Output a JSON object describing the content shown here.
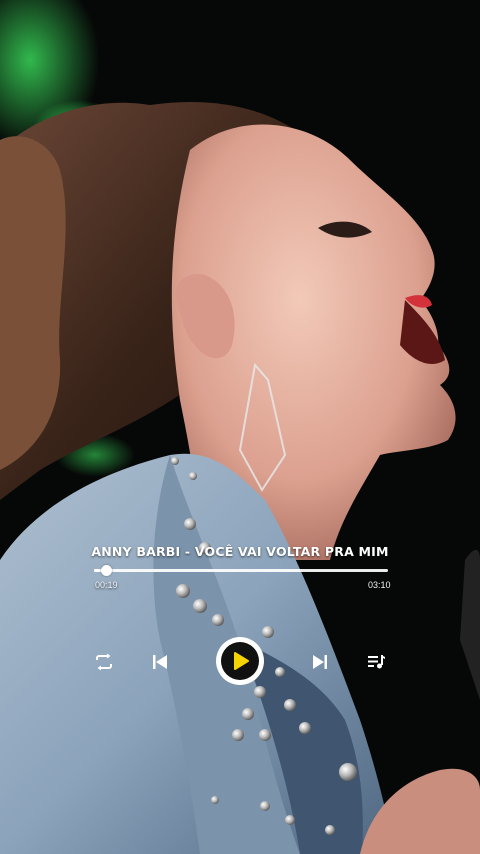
{
  "player": {
    "song_title": "ANNY BARBI - VOCÊ VAI VOLTAR PRA MIM",
    "elapsed": "00:19",
    "total": "03:10",
    "progress_fraction": 0.041,
    "accent_color": "#f5d400"
  },
  "controls": {
    "repeat": "repeat-icon",
    "previous": "skip-previous-icon",
    "play": "play-icon",
    "next": "skip-next-icon",
    "queue": "playlist-queue-icon"
  }
}
